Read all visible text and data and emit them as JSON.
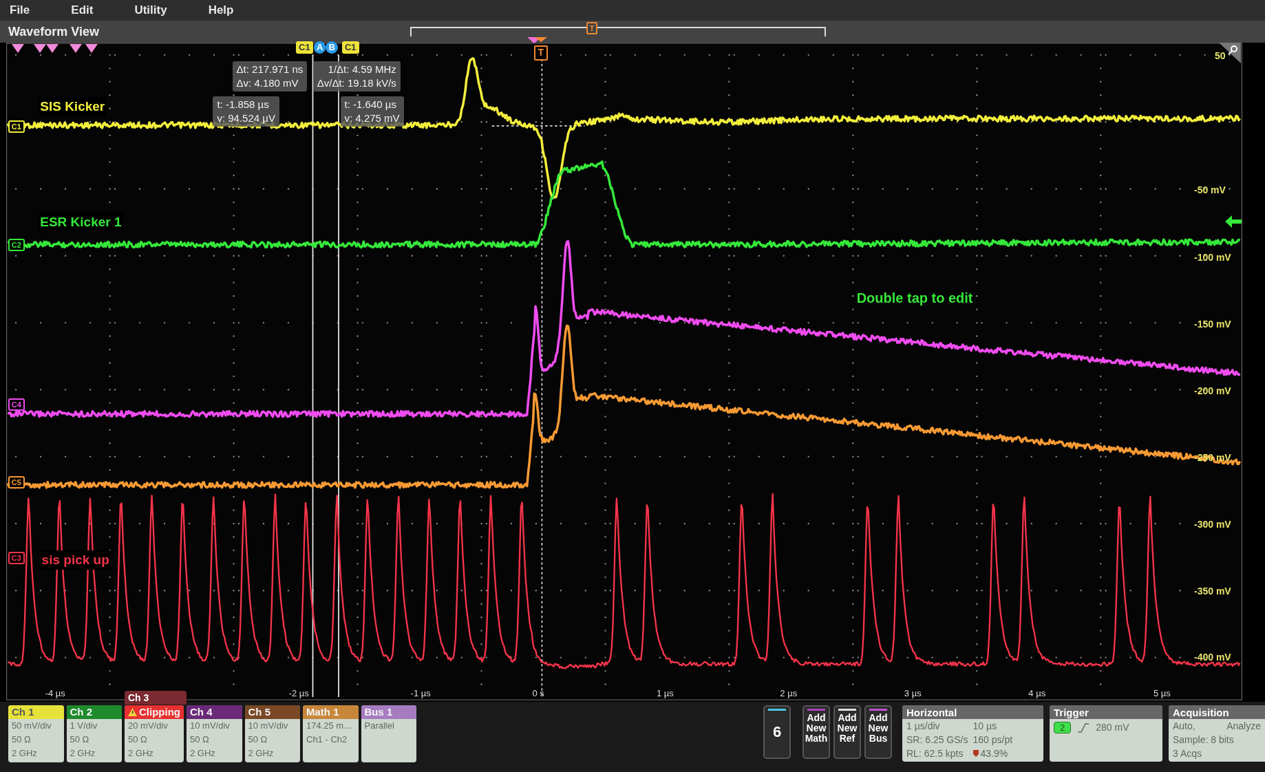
{
  "menu": [
    "File",
    "Edit",
    "Utility",
    "Help"
  ],
  "view_title": "Waveform View",
  "overview_trigger": "T",
  "cursor_tags": [
    {
      "label": "C1",
      "kind": "channel"
    },
    {
      "label": "A",
      "kind": "cursor"
    },
    {
      "label": "B",
      "kind": "cursor"
    },
    {
      "label": "C1",
      "kind": "channel"
    }
  ],
  "trigger_marker": "T",
  "readouts": [
    {
      "lines": [
        "Δt: 217.971 ns",
        "Δv: 4.180 mV"
      ]
    },
    {
      "lines": [
        "1/Δt: 4.59 MHz",
        "Δv/Δt: 19.18 kV/s"
      ]
    },
    {
      "lines": [
        "t: -1.858 µs",
        "v: 94.524 µV"
      ]
    },
    {
      "lines": [
        "t: -1.640 µs",
        "v: 4.275 mV"
      ]
    }
  ],
  "traces": [
    {
      "handle": "C1",
      "label": "SIS Kicker",
      "color": "#f2ee3c"
    },
    {
      "handle": "C2",
      "label": "ESR Kicker 1",
      "color": "#35e83a"
    },
    {
      "handle": "C4",
      "color": "#f04cf0"
    },
    {
      "handle": "C5",
      "color": "#f79a34"
    },
    {
      "handle": "C3",
      "label": "sis pick up",
      "color": "#f5344a"
    }
  ],
  "hint": "Double tap to edit",
  "y_labels": [
    "50",
    "-50 mV",
    "-100 mV",
    "-150 mV",
    "-200 mV",
    "-250 mV",
    "-300 mV",
    "-350 mV",
    "-400 mV"
  ],
  "x_labels": [
    "-4 µs",
    "-2 µs",
    "-1 µs",
    "0 s",
    "1 µs",
    "2 µs",
    "3 µs",
    "4 µs",
    "5 µs"
  ],
  "channels": [
    {
      "name": "Ch 1",
      "color": "#e6e23a",
      "lines": [
        "50 mV/div",
        "50 Ω",
        "2 GHz"
      ]
    },
    {
      "name": "Ch 2",
      "color": "#1e8a2c",
      "lines": [
        "1 V/div",
        "50 Ω",
        "2 GHz"
      ]
    },
    {
      "name": "Ch 3",
      "warning": "Clipping",
      "color": "#e83030",
      "lines": [
        "20 mV/div",
        "50 Ω",
        "2 GHz"
      ]
    },
    {
      "name": "Ch 4",
      "color": "#6a2a78",
      "lines": [
        "10 mV/div",
        "50 Ω",
        "2 GHz"
      ]
    },
    {
      "name": "Ch 5",
      "color": "#7a4824",
      "lines": [
        "10 mV/div",
        "50 Ω",
        "2 GHz"
      ]
    },
    {
      "name": "Math 1",
      "color": "#c8863a",
      "lines": [
        "174.25 m…",
        "Ch1 - Ch2"
      ]
    },
    {
      "name": "Bus 1",
      "color": "#a57cc0",
      "lines": [
        "Parallel"
      ]
    }
  ],
  "count_button": {
    "label": "6",
    "color": "#4cc8e0"
  },
  "add_buttons": [
    {
      "lines": [
        "Add",
        "New",
        "Math"
      ],
      "color": "#b040c0"
    },
    {
      "lines": [
        "Add",
        "New",
        "Ref"
      ],
      "color": "#e0e0e0"
    },
    {
      "lines": [
        "Add",
        "New",
        "Bus"
      ],
      "color": "#c050d0"
    }
  ],
  "horizontal": {
    "title": "Horizontal",
    "rows": [
      [
        "1 µs/div",
        "10 µs"
      ],
      [
        "SR: 6.25 GS/s",
        "160 ps/pt"
      ],
      [
        "RL: 62.5 kpts",
        "43.9%"
      ]
    ]
  },
  "trigger": {
    "title": "Trigger",
    "source": "2",
    "level": "280 mV"
  },
  "acquisition": {
    "title": "Acquisition",
    "lines": [
      [
        "Auto,",
        "Analyze"
      ],
      [
        "Sample: 8 bits"
      ],
      [
        "3 Acqs"
      ]
    ]
  }
}
